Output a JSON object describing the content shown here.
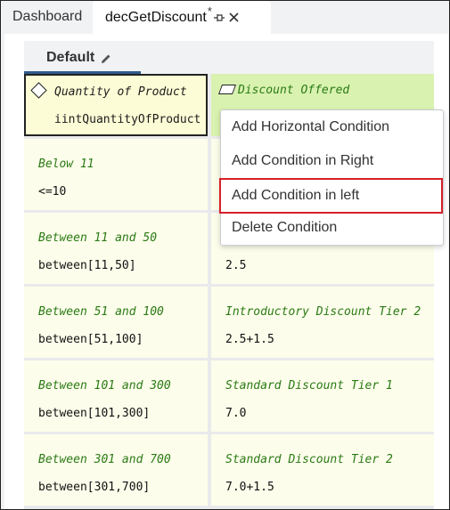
{
  "tabs": {
    "dashboard": "Dashboard",
    "active": "decGetDiscount",
    "dirty_marker": "*"
  },
  "subtab": {
    "label": "Default"
  },
  "header": {
    "left_title": "Quantity of Product",
    "left_value": "iintQuantityOfProduct",
    "right_title": "Discount Offered"
  },
  "rows": [
    {
      "condition_title": "Below 11",
      "condition_value": "<=10",
      "result_title": "",
      "result_value": ""
    },
    {
      "condition_title": "Between 11 and 50",
      "condition_value": "between[11,50]",
      "result_title": "",
      "result_value": "2.5"
    },
    {
      "condition_title": "Between 51 and 100",
      "condition_value": "between[51,100]",
      "result_title": "Introductory Discount Tier 2",
      "result_value": "2.5+1.5"
    },
    {
      "condition_title": "Between 101 and 300",
      "condition_value": "between[101,300]",
      "result_title": "Standard Discount Tier 1",
      "result_value": "7.0"
    },
    {
      "condition_title": "Between 301 and 700",
      "condition_value": "between[301,700]",
      "result_title": "Standard Discount Tier 2",
      "result_value": "7.0+1.5"
    }
  ],
  "context_menu": {
    "items": [
      "Add Horizontal Condition",
      "Add Condition in Right",
      "Add Condition in left",
      "Delete Condition"
    ],
    "highlight_color": "#d6202a"
  },
  "colors": {
    "condition_title": "#2a7a14",
    "cell_bg": "#fdfdeb",
    "header_right_bg": "#d9f2b0",
    "header_left_bg": "#fcfcd6"
  }
}
